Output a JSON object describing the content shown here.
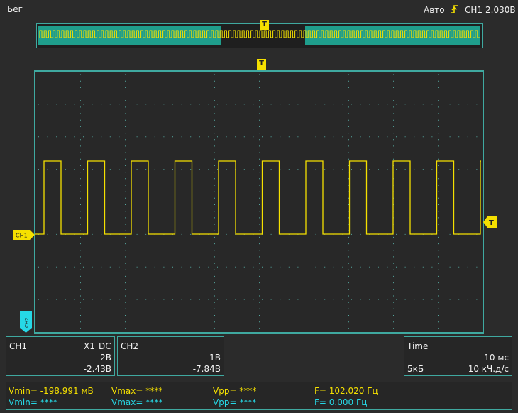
{
  "header": {
    "run_status": "Бег",
    "trigger_mode": "Авто",
    "trigger_source": "CH1",
    "trigger_level": "2.030В",
    "trigger_icon": "rising-edge-icon"
  },
  "markers": {
    "trigger_time": "T",
    "channel1": "CH1",
    "channel2": "CH2",
    "trigger_level_marker": "T"
  },
  "channel1": {
    "label": "CH1",
    "probe": "X1",
    "coupling": "DC",
    "volts_per_div": "2В",
    "offset": "-2.43В",
    "color": "#f5e000"
  },
  "channel2": {
    "label": "CH2",
    "volts_per_div": "1В",
    "offset": "-7.84В",
    "color": "#26d8e6"
  },
  "timebase": {
    "label": "Time",
    "time_per_div": "10 мс",
    "memory_depth": "5кБ",
    "sample_rate": "10 кЧ.д/с"
  },
  "measurements": {
    "ch1": {
      "vmin": "Vmin= -198.991 мВ",
      "vmax": "Vmax= ****",
      "vpp": "Vpp= ****",
      "freq": "F= 102.020 Гц"
    },
    "ch2": {
      "vmin": "Vmin= ****",
      "vmax": "Vmax= ****",
      "vpp": "Vpp= ****",
      "freq": "F= 0.000 Гц"
    }
  },
  "colors": {
    "grid_border": "#3fa9a0",
    "trace": "#f5e000",
    "overview_fill": "#1f9e8c"
  }
}
